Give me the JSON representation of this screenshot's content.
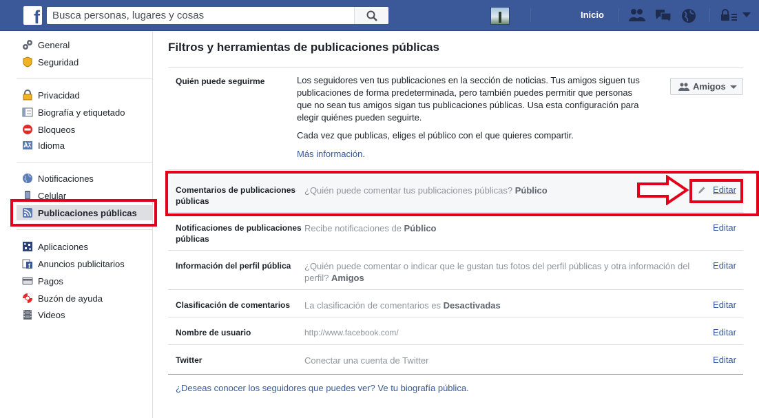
{
  "topbar": {
    "logo_letter": "f",
    "search_placeholder": "Busca personas, lugares y cosas",
    "home_label": "Inicio",
    "icons": [
      "search-icon",
      "friend-requests-icon",
      "messages-icon",
      "notifications-globe-icon",
      "privacy-lock-icon",
      "account-menu-caret-icon"
    ]
  },
  "sidebar": {
    "groups": [
      [
        {
          "label": "General",
          "icon": "gears-icon"
        },
        {
          "label": "Seguridad",
          "icon": "shield-icon"
        }
      ],
      [
        {
          "label": "Privacidad",
          "icon": "padlock-icon"
        },
        {
          "label": "Biografía y etiquetado",
          "icon": "timeline-icon"
        },
        {
          "label": "Bloqueos",
          "icon": "block-icon"
        },
        {
          "label": "Idioma",
          "icon": "language-icon"
        }
      ],
      [
        {
          "label": "Notificaciones",
          "icon": "globe-icon"
        },
        {
          "label": "Celular",
          "icon": "phone-icon"
        },
        {
          "label": "Publicaciones públicas",
          "icon": "rss-icon",
          "active": true
        }
      ],
      [
        {
          "label": "Aplicaciones",
          "icon": "apps-icon"
        },
        {
          "label": "Anuncios publicitarios",
          "icon": "ads-icon"
        },
        {
          "label": "Pagos",
          "icon": "card-icon"
        },
        {
          "label": "Buzón de ayuda",
          "icon": "lifebuoy-icon"
        },
        {
          "label": "Videos",
          "icon": "film-icon"
        }
      ]
    ]
  },
  "main": {
    "title": "Filtros y herramientas de publicaciones públicas",
    "follow": {
      "label": "Quién puede seguirme",
      "description": "Los seguidores ven tus publicaciones en la sección de noticias. Tus amigos siguen tus publicaciones de forma predeterminada, pero también puedes permitir que personas que no sean tus amigos sigan tus publicaciones públicas. Usa esta configuración para elegir quiénes pueden seguirte.",
      "note": "Cada vez que publicas, eliges el público con el que quieres compartir.",
      "more_link": "Más información.",
      "audience_button": "Amigos"
    },
    "rows": [
      {
        "label": "Comentarios de publicaciones públicas",
        "value_prefix": "¿Quién puede comentar tus publicaciones públicas?",
        "value_bold": "Público",
        "edit": "Editar"
      },
      {
        "label": "Notificaciones de publicaciones públicas",
        "value_prefix": "Recibe notificaciones de",
        "value_bold": "Público",
        "edit": "Editar"
      },
      {
        "label": "Información del perfil pública",
        "value_prefix": "¿Quién puede comentar o indicar que le gustan tus fotos del perfil públicas y otra información del perfil?",
        "value_bold": "Amigos",
        "edit": "Editar"
      },
      {
        "label": "Clasificación de comentarios",
        "value_prefix": "La clasificación de comentarios es",
        "value_bold": "Desactivadas",
        "edit": "Editar"
      },
      {
        "label": "Nombre de usuario",
        "value_prefix": "http://www.facebook.com/",
        "value_bold": "",
        "edit": "Editar"
      },
      {
        "label": "Twitter",
        "value_prefix": "Conectar una cuenta de Twitter",
        "value_bold": "",
        "edit": "Editar"
      }
    ],
    "footer_link": "¿Deseas conocer los seguidores que puedes ver? Ve tu biografía pública."
  },
  "colors": {
    "topbar": "#3b5998",
    "link": "#365899",
    "annotation": "#e3001b"
  }
}
